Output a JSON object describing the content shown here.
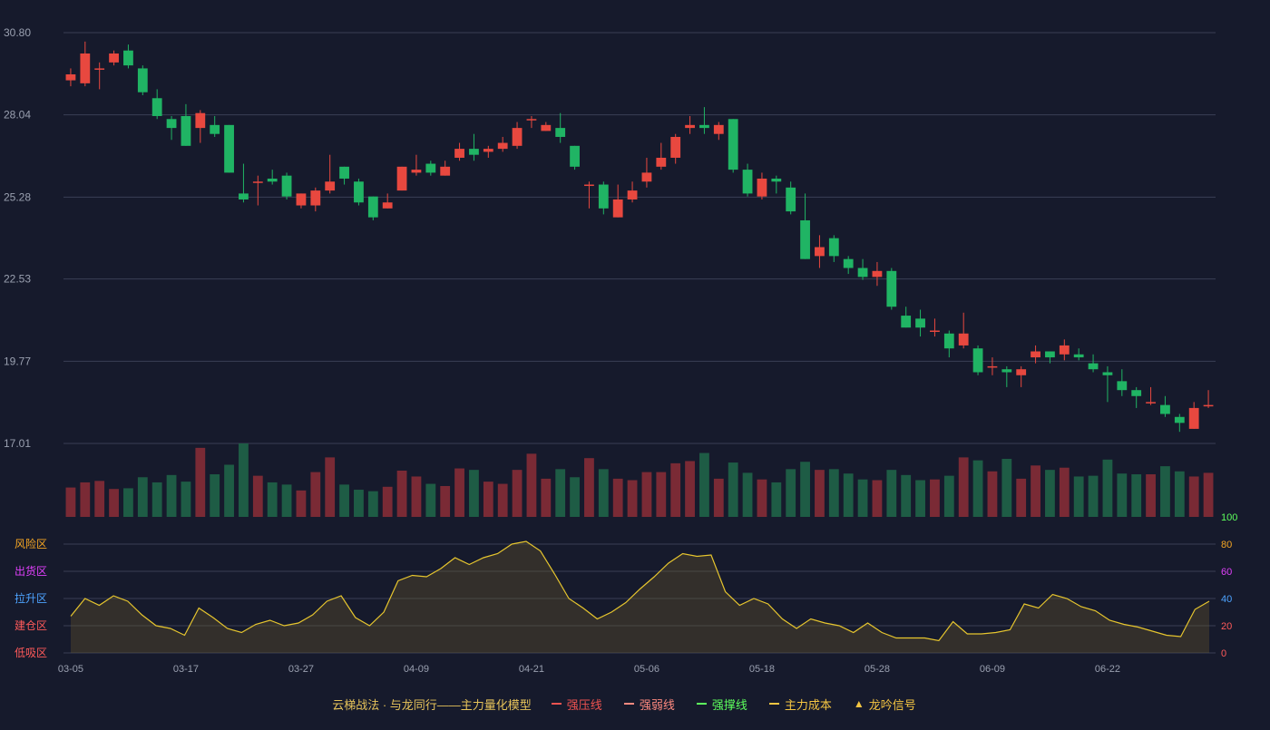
{
  "chart_data": {
    "type": "candlestick",
    "price_axis": {
      "ticks": [
        "30.80",
        "28.04",
        "25.28",
        "22.53",
        "19.77",
        "17.01"
      ],
      "min": 17.01,
      "max": 30.8
    },
    "date_ticks": [
      {
        "index": 0,
        "label": "03-05"
      },
      {
        "index": 8,
        "label": "03-17"
      },
      {
        "index": 16,
        "label": "03-27"
      },
      {
        "index": 24,
        "label": "04-09"
      },
      {
        "index": 32,
        "label": "04-21"
      },
      {
        "index": 40,
        "label": "05-06"
      },
      {
        "index": 48,
        "label": "05-18"
      },
      {
        "index": 56,
        "label": "05-28"
      },
      {
        "index": 64,
        "label": "06-09"
      },
      {
        "index": 72,
        "label": "06-22"
      }
    ],
    "candles": [
      [
        29.2,
        29.4,
        29.6,
        29.0
      ],
      [
        29.1,
        30.1,
        30.5,
        29.0
      ],
      [
        29.6,
        29.6,
        29.8,
        28.9
      ],
      [
        29.8,
        30.1,
        30.2,
        29.7
      ],
      [
        30.2,
        29.7,
        30.4,
        29.6
      ],
      [
        29.6,
        28.8,
        29.7,
        28.7
      ],
      [
        28.6,
        28.0,
        28.9,
        27.9
      ],
      [
        27.9,
        27.6,
        28.0,
        27.2
      ],
      [
        28.0,
        27.0,
        28.4,
        27.0
      ],
      [
        27.6,
        28.1,
        28.2,
        27.1
      ],
      [
        27.7,
        27.4,
        28.0,
        27.3
      ],
      [
        27.7,
        26.1,
        27.7,
        26.1
      ],
      [
        25.4,
        25.2,
        26.4,
        25.1
      ],
      [
        25.8,
        25.8,
        26.0,
        25.0
      ],
      [
        25.9,
        25.8,
        26.2,
        25.7
      ],
      [
        26.0,
        25.3,
        26.1,
        25.2
      ],
      [
        25.0,
        25.4,
        25.4,
        24.9
      ],
      [
        25.0,
        25.5,
        25.6,
        24.8
      ],
      [
        25.5,
        25.8,
        26.7,
        25.4
      ],
      [
        26.3,
        25.9,
        26.3,
        25.7
      ],
      [
        25.8,
        25.1,
        25.9,
        25.0
      ],
      [
        25.3,
        24.6,
        25.3,
        24.5
      ],
      [
        24.9,
        25.1,
        25.4,
        24.9
      ],
      [
        25.5,
        26.3,
        26.3,
        25.5
      ],
      [
        26.1,
        26.2,
        26.7,
        26.0
      ],
      [
        26.4,
        26.1,
        26.5,
        26.0
      ],
      [
        26.0,
        26.3,
        26.5,
        26.0
      ],
      [
        26.6,
        26.9,
        27.1,
        26.5
      ],
      [
        26.9,
        26.7,
        27.4,
        26.5
      ],
      [
        26.8,
        26.9,
        27.0,
        26.6
      ],
      [
        26.9,
        27.1,
        27.3,
        26.8
      ],
      [
        27.0,
        27.6,
        27.8,
        26.9
      ],
      [
        27.9,
        27.9,
        28.0,
        27.6
      ],
      [
        27.5,
        27.7,
        27.8,
        27.5
      ],
      [
        27.6,
        27.3,
        28.1,
        27.1
      ],
      [
        27.0,
        26.3,
        27.0,
        26.2
      ],
      [
        25.7,
        25.7,
        25.8,
        24.9
      ],
      [
        25.7,
        24.9,
        25.8,
        24.7
      ],
      [
        24.6,
        25.2,
        25.7,
        24.6
      ],
      [
        25.2,
        25.5,
        25.8,
        25.1
      ],
      [
        25.8,
        26.1,
        26.6,
        25.6
      ],
      [
        26.3,
        26.6,
        27.1,
        26.2
      ],
      [
        26.6,
        27.3,
        27.4,
        26.4
      ],
      [
        27.6,
        27.7,
        28.0,
        27.4
      ],
      [
        27.7,
        27.6,
        28.3,
        27.4
      ],
      [
        27.4,
        27.7,
        27.8,
        27.2
      ],
      [
        27.9,
        26.2,
        27.9,
        26.1
      ],
      [
        26.2,
        25.4,
        26.4,
        25.3
      ],
      [
        25.3,
        25.9,
        26.1,
        25.2
      ],
      [
        25.9,
        25.8,
        26.0,
        25.4
      ],
      [
        25.6,
        24.8,
        25.8,
        24.7
      ],
      [
        24.5,
        23.2,
        25.4,
        23.2
      ],
      [
        23.3,
        23.6,
        24.0,
        22.9
      ],
      [
        23.9,
        23.3,
        24.0,
        23.1
      ],
      [
        23.2,
        22.9,
        23.3,
        22.7
      ],
      [
        22.9,
        22.6,
        23.2,
        22.5
      ],
      [
        22.6,
        22.8,
        23.1,
        22.3
      ],
      [
        22.8,
        21.6,
        22.9,
        21.5
      ],
      [
        21.3,
        20.9,
        21.6,
        20.9
      ],
      [
        21.2,
        20.9,
        21.5,
        20.6
      ],
      [
        20.8,
        20.8,
        21.2,
        20.6
      ],
      [
        20.7,
        20.2,
        20.8,
        19.9
      ],
      [
        20.3,
        20.7,
        21.4,
        20.2
      ],
      [
        20.2,
        19.4,
        20.3,
        19.3
      ],
      [
        19.6,
        19.6,
        19.9,
        19.3
      ],
      [
        19.5,
        19.4,
        19.6,
        18.9
      ],
      [
        19.3,
        19.5,
        19.6,
        18.9
      ],
      [
        19.9,
        20.1,
        20.3,
        19.7
      ],
      [
        20.1,
        19.9,
        20.1,
        19.7
      ],
      [
        20.0,
        20.3,
        20.5,
        19.8
      ],
      [
        20.0,
        19.9,
        20.2,
        19.8
      ],
      [
        19.7,
        19.5,
        20.0,
        19.4
      ],
      [
        19.4,
        19.3,
        19.6,
        18.4
      ],
      [
        19.1,
        18.8,
        19.5,
        18.6
      ],
      [
        18.8,
        18.6,
        18.9,
        18.2
      ],
      [
        18.4,
        18.4,
        18.9,
        18.3
      ],
      [
        18.3,
        18.0,
        18.6,
        17.9
      ],
      [
        17.9,
        17.7,
        18.0,
        17.4
      ],
      [
        17.5,
        18.2,
        18.4,
        17.5
      ],
      [
        18.3,
        18.3,
        18.8,
        18.2
      ]
    ],
    "volume": [
      0.4,
      0.47,
      0.49,
      0.38,
      0.39,
      0.54,
      0.47,
      0.57,
      0.48,
      0.94,
      0.58,
      0.71,
      1.0,
      0.56,
      0.47,
      0.44,
      0.36,
      0.61,
      0.81,
      0.44,
      0.37,
      0.35,
      0.41,
      0.63,
      0.55,
      0.45,
      0.42,
      0.66,
      0.64,
      0.48,
      0.45,
      0.64,
      0.86,
      0.52,
      0.65,
      0.54,
      0.8,
      0.65,
      0.52,
      0.5,
      0.61,
      0.61,
      0.73,
      0.76,
      0.87,
      0.52,
      0.74,
      0.6,
      0.51,
      0.47,
      0.65,
      0.75,
      0.64,
      0.65,
      0.59,
      0.51,
      0.5,
      0.64,
      0.57,
      0.5,
      0.51,
      0.56,
      0.81,
      0.77,
      0.62,
      0.79,
      0.52,
      0.7,
      0.64,
      0.67,
      0.55,
      0.56,
      0.78,
      0.59,
      0.58,
      0.58,
      0.69,
      0.62,
      0.55,
      0.6
    ],
    "oscillator": {
      "axis_ticks": [
        "100",
        "80",
        "60",
        "40",
        "20",
        "0"
      ],
      "zone_labels": [
        "风险区",
        "出货区",
        "拉升区",
        "建仓区",
        "低吸区"
      ],
      "values": [
        27,
        40,
        35,
        42,
        38,
        28,
        20,
        18,
        13,
        33,
        26,
        18,
        15,
        21,
        24,
        20,
        22,
        28,
        38,
        42,
        26,
        20,
        30,
        53,
        57,
        56,
        62,
        70,
        65,
        70,
        73,
        80,
        82,
        75,
        58,
        40,
        33,
        25,
        30,
        37,
        47,
        56,
        66,
        73,
        71,
        72,
        45,
        35,
        40,
        36,
        25,
        18,
        25,
        22,
        20,
        15,
        22,
        15,
        11,
        11,
        11,
        9,
        23,
        14,
        14,
        15,
        17,
        36,
        33,
        43,
        40,
        34,
        31,
        24,
        21,
        19,
        16,
        13,
        12,
        32,
        38
      ]
    },
    "legend": {
      "title": "云梯战法 · 与龙同行——主力量化模型",
      "items": [
        {
          "label": "强压线",
          "color": "#ef5350",
          "style": "solid"
        },
        {
          "label": "强弱线",
          "color": "#ff8a80",
          "style": "dashed"
        },
        {
          "label": "强撑线",
          "color": "#5dff5d",
          "style": "solid"
        },
        {
          "label": "主力成本",
          "color": "#f5c542",
          "style": "dashed"
        },
        {
          "label": "龙吟信号",
          "color": "#f5c542",
          "style": "triangle"
        }
      ]
    },
    "colors": {
      "up": "#e8483f",
      "down": "#20b464",
      "vol_up": "#7a2a35",
      "vol_down": "#1e5c45",
      "oscillator_line": "#e6c52e",
      "grid": "#3a3f55",
      "axis_text": "#9aa0b0",
      "zone_risk": "#f5a623",
      "zone_ship": "#e040fb",
      "zone_pull": "#4da3ff",
      "zone_build": "#ff5a5a",
      "zone_low": "#ff5a5a",
      "tick_100": "#5dff5d",
      "tick_80": "#f5a623",
      "tick_60": "#e040fb",
      "tick_40": "#4da3ff",
      "tick_20": "#ff5a5a",
      "tick_0": "#ff5a5a"
    }
  }
}
